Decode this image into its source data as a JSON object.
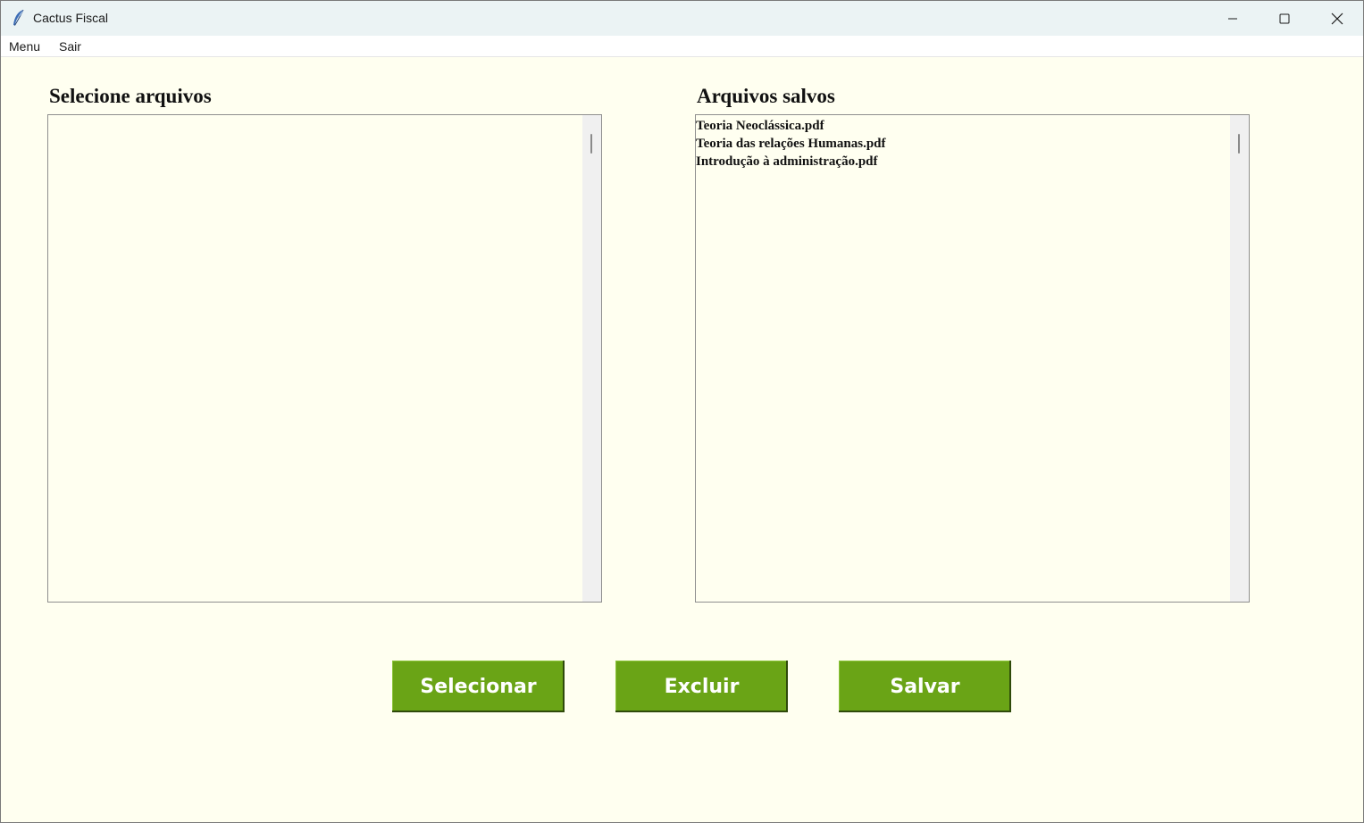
{
  "window": {
    "title": "Cactus Fiscal",
    "app_icon": "feather-icon",
    "controls": [
      "minimize-icon",
      "maximize-icon",
      "close-icon"
    ]
  },
  "menubar": {
    "items": [
      {
        "label": "Menu"
      },
      {
        "label": "Sair"
      }
    ]
  },
  "left_panel": {
    "title": "Selecione arquivos",
    "items": []
  },
  "right_panel": {
    "title": "Arquivos salvos",
    "items": [
      "Teoria Neoclássica.pdf",
      "Teoria das relações Humanas.pdf",
      "Introdução à administração.pdf"
    ]
  },
  "buttons": {
    "select_label": "Selecionar",
    "delete_label": "Excluir",
    "save_label": "Salvar"
  },
  "colors": {
    "background": "#fffff0",
    "titlebar": "#ebf3f4",
    "button": "#6aa416",
    "button_text": "#ffffff"
  }
}
